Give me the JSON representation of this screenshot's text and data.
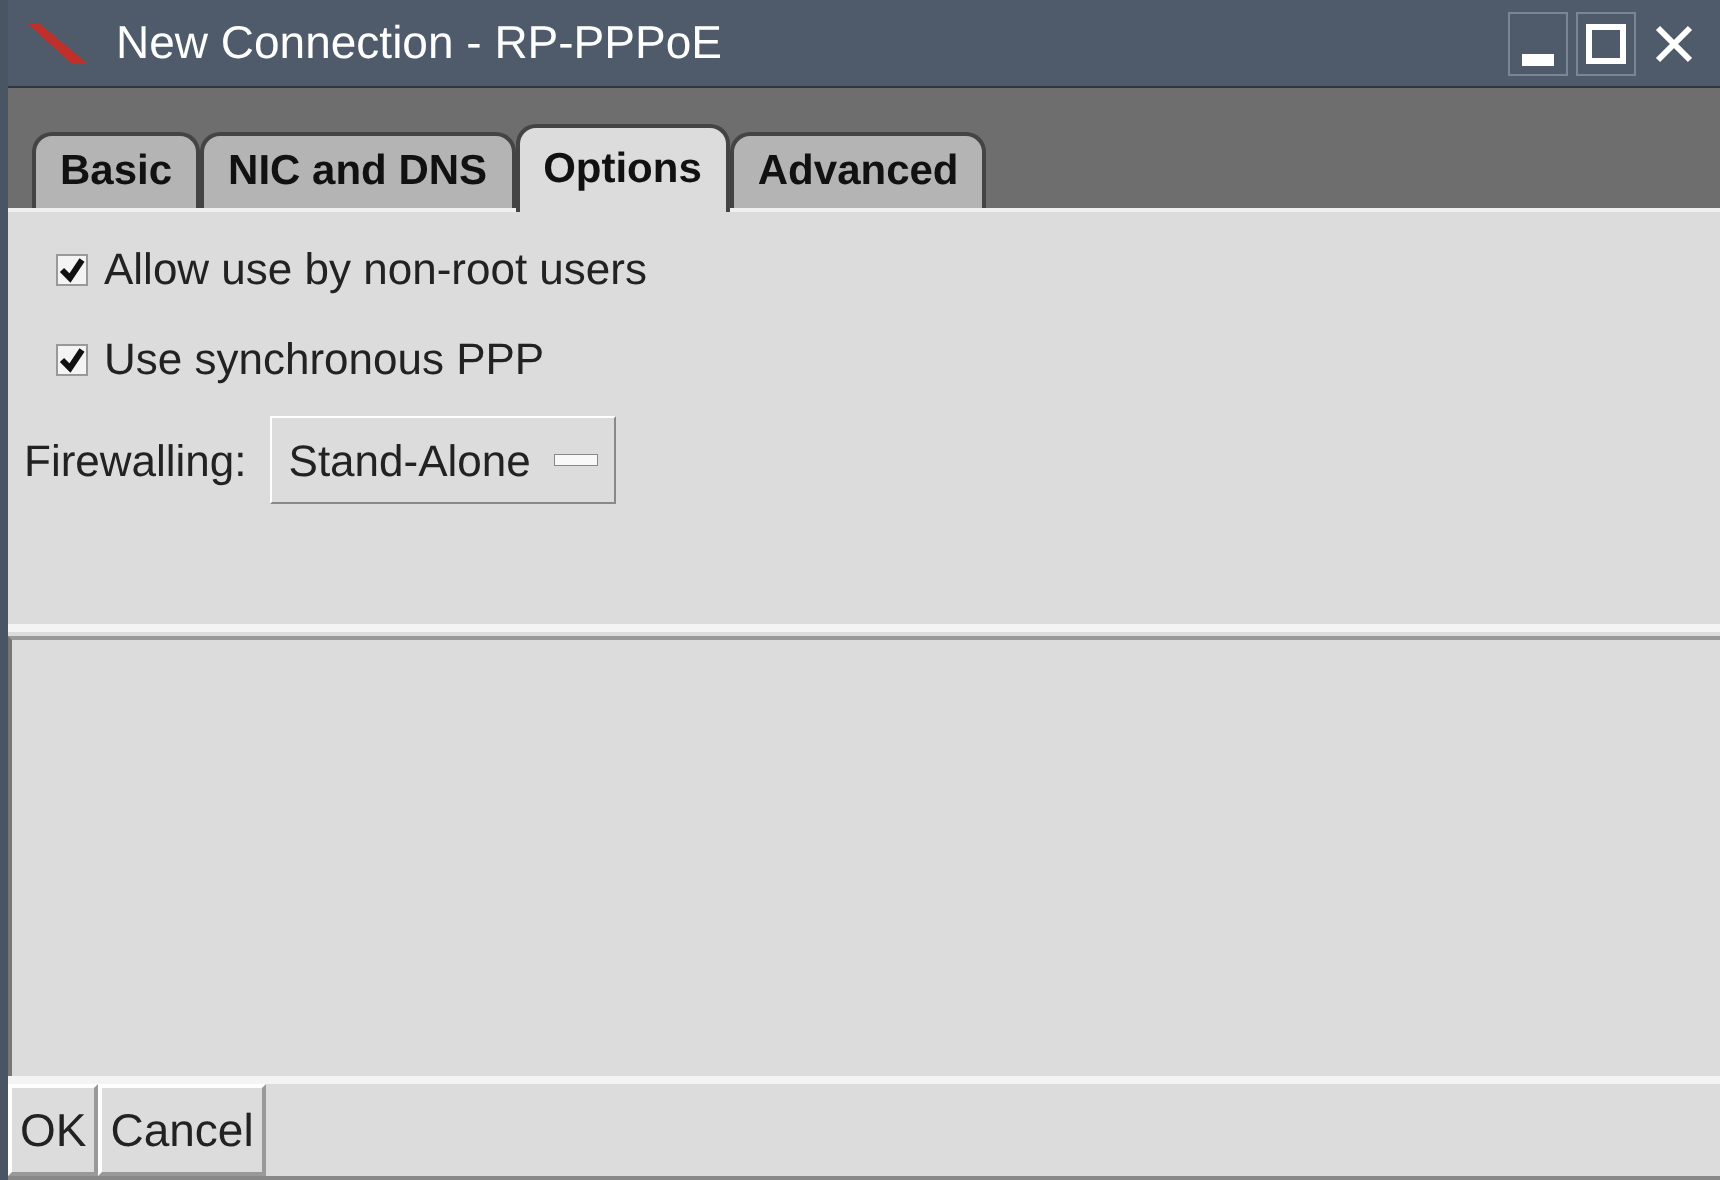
{
  "window": {
    "title": "New Connection - RP-PPPoE"
  },
  "tabs": [
    {
      "label": "Basic",
      "selected": false
    },
    {
      "label": "NIC and DNS",
      "selected": false
    },
    {
      "label": "Options",
      "selected": true
    },
    {
      "label": "Advanced",
      "selected": false
    }
  ],
  "options": [
    {
      "label": "Allow use by non-root users",
      "checked": true
    },
    {
      "label": "Use synchronous PPP",
      "checked": true
    }
  ],
  "firewalling": {
    "label": "Firewalling:",
    "value": "Stand-Alone"
  },
  "buttons": [
    "OK",
    "Cancel"
  ]
}
